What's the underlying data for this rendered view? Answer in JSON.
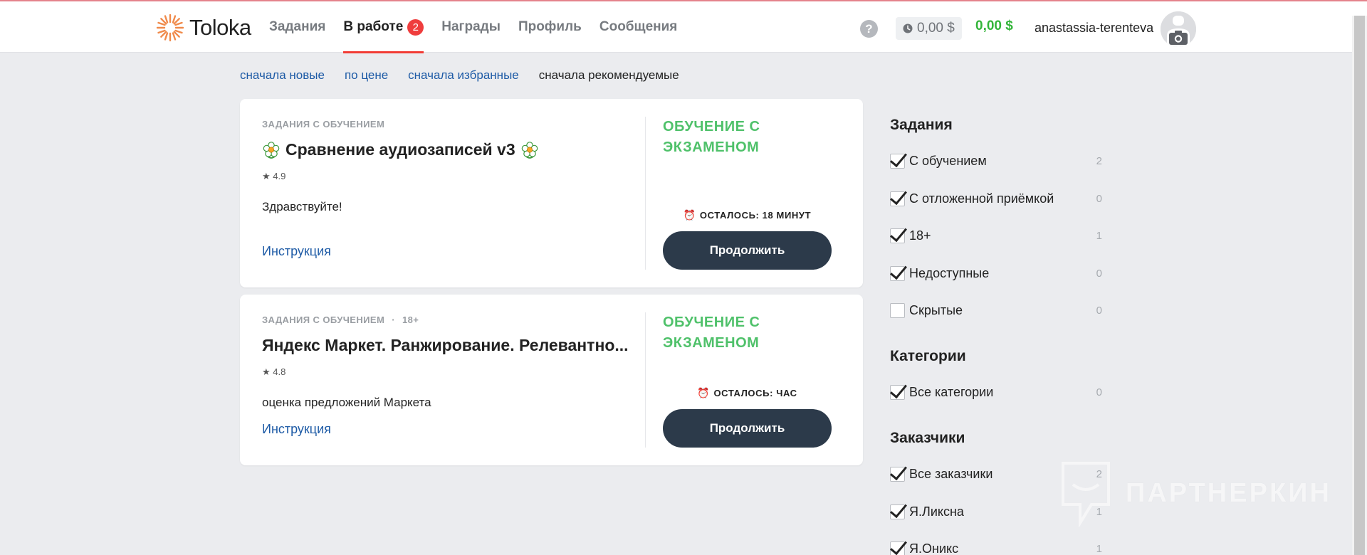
{
  "header": {
    "logo_text": "Toloka",
    "nav": [
      {
        "label": "Задания"
      },
      {
        "label": "В работе",
        "badge": "2",
        "active": true
      },
      {
        "label": "Награды"
      },
      {
        "label": "Профиль"
      },
      {
        "label": "Сообщения"
      }
    ],
    "help_label": "?",
    "balance_pending": "0,00 $",
    "balance": "0,00 $",
    "username": "anastassia-terenteva"
  },
  "sort": {
    "options": [
      "сначала новые",
      "по цене",
      "сначала избранные"
    ],
    "current": "сначала рекомендуемые"
  },
  "tasks": [
    {
      "type": "ЗАДАНИЯ С ОБУЧЕНИЕМ",
      "title": "Сравнение аудиозаписей v3",
      "rating": "4.9",
      "description": "Здравствуйте!",
      "instruction_label": "Инструкция",
      "training_label": "ОБУЧЕНИЕ С ЭКЗАМЕНОМ",
      "time_left": "ОСТАЛОСЬ: 18 МИНУТ",
      "button_label": "Продолжить"
    },
    {
      "type": "ЗАДАНИЯ С ОБУЧЕНИЕМ",
      "age_tag": "18+",
      "title": "Яндекс Маркет. Ранжирование. Релевантно...",
      "rating": "4.8",
      "description": "оценка предложений Маркета",
      "instruction_label": "Инструкция",
      "training_label": "ОБУЧЕНИЕ С ЭКЗАМЕНОМ",
      "time_left": "ОСТАЛОСЬ: ЧАС",
      "button_label": "Продолжить"
    }
  ],
  "sidebar": {
    "tasks_heading": "Задания",
    "task_filters": [
      {
        "label": "С обучением",
        "count": "2",
        "checked": true
      },
      {
        "label": "С отложенной приёмкой",
        "count": "0",
        "checked": true
      },
      {
        "label": "18+",
        "count": "1",
        "checked": true
      },
      {
        "label": "Недоступные",
        "count": "0",
        "checked": true
      },
      {
        "label": "Скрытые",
        "count": "0",
        "checked": false
      }
    ],
    "categories_heading": "Категории",
    "category_filters": [
      {
        "label": "Все категории",
        "count": "0",
        "checked": true
      }
    ],
    "customers_heading": "Заказчики",
    "customer_filters": [
      {
        "label": "Все заказчики",
        "count": "2",
        "checked": true
      },
      {
        "label": "Я.Ликсна",
        "count": "1",
        "checked": true
      },
      {
        "label": "Я.Оникс",
        "count": "1",
        "checked": true
      }
    ]
  },
  "watermark": "ПАРТНЕРКИН",
  "colors": {
    "accent_red": "#f23c35",
    "link_blue": "#1e5ba6",
    "green": "#4fc16a",
    "button_dark": "#2c3a4a"
  }
}
